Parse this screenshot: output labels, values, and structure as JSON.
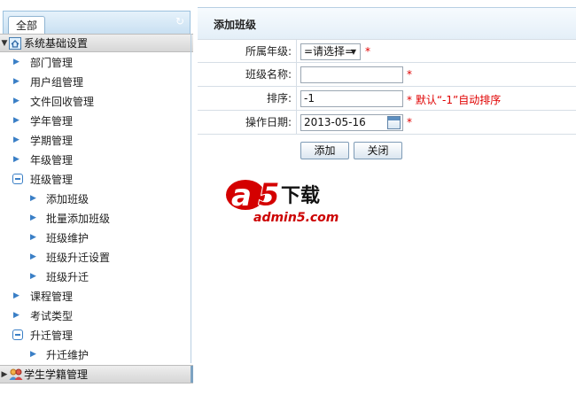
{
  "sidebar": {
    "tab_all": "全部",
    "groups": [
      {
        "label": "系统基础设置",
        "icon": "home-icon",
        "expanded": true
      },
      {
        "label": "学生学籍管理",
        "icon": "students-icon",
        "expanded": false
      }
    ],
    "menu": [
      {
        "label": "部门管理",
        "level": 1,
        "type": "item"
      },
      {
        "label": "用户组管理",
        "level": 1,
        "type": "item"
      },
      {
        "label": "文件回收管理",
        "level": 1,
        "type": "item"
      },
      {
        "label": "学年管理",
        "level": 1,
        "type": "item"
      },
      {
        "label": "学期管理",
        "level": 1,
        "type": "item"
      },
      {
        "label": "年级管理",
        "level": 1,
        "type": "item"
      },
      {
        "label": "班级管理",
        "level": 1,
        "type": "folder"
      },
      {
        "label": "添加班级",
        "level": 2,
        "type": "item"
      },
      {
        "label": "批量添加班级",
        "level": 2,
        "type": "item"
      },
      {
        "label": "班级维护",
        "level": 2,
        "type": "item"
      },
      {
        "label": "班级升迁设置",
        "level": 2,
        "type": "item"
      },
      {
        "label": "班级升迁",
        "level": 2,
        "type": "item"
      },
      {
        "label": "课程管理",
        "level": 1,
        "type": "item"
      },
      {
        "label": "考试类型",
        "level": 1,
        "type": "item"
      },
      {
        "label": "升迁管理",
        "level": 1,
        "type": "folder"
      },
      {
        "label": "升迁维护",
        "level": 2,
        "type": "item"
      }
    ]
  },
  "main": {
    "title": "添加班级",
    "form": {
      "grade_label": "所属年级:",
      "grade_value": "=请选择=",
      "class_name_label": "班级名称:",
      "class_name_value": "",
      "sort_label": "排序:",
      "sort_value": "-1",
      "sort_hint": "* 默认“-1”自动排序",
      "date_label": "操作日期:",
      "date_value": "2013-05-16",
      "required_mark": "*"
    },
    "buttons": {
      "add": "添加",
      "close": "关闭"
    }
  },
  "watermark": {
    "text": "admin5.com",
    "logo_label": "下载"
  },
  "colors": {
    "accent": "#3a7fc6",
    "required": "#e00000",
    "header_bg": "#c9e0f2"
  }
}
